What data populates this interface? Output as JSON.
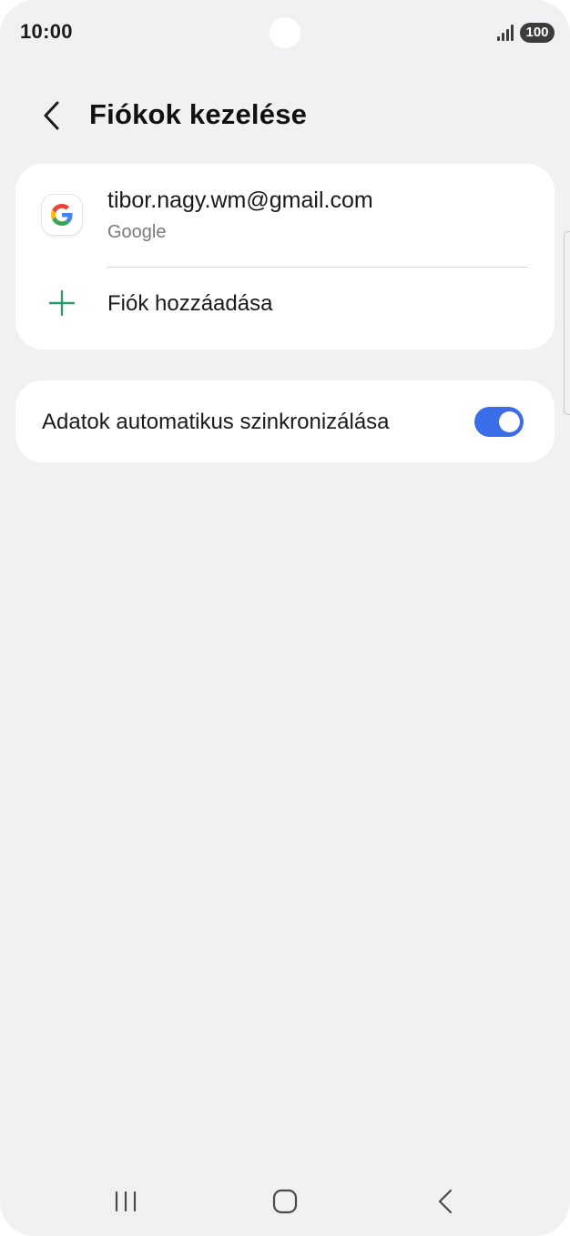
{
  "status_bar": {
    "time": "10:00",
    "battery": "100",
    "icons": [
      "signal-icon",
      "battery-icon"
    ]
  },
  "header": {
    "title": "Fiókok kezelése",
    "back_icon": "back-chevron-icon"
  },
  "accounts": {
    "items": [
      {
        "email": "tibor.nagy.wm@gmail.com",
        "type": "Google",
        "icon": "google-icon"
      }
    ],
    "add_label": "Fiók hozzáadása",
    "add_icon": "plus-icon"
  },
  "sync": {
    "label": "Adatok automatikus szinkronizálása",
    "enabled": true
  },
  "navigation": {
    "icons": [
      "recents-icon",
      "home-icon",
      "back-icon"
    ]
  },
  "colors": {
    "background": "#f1f1f3",
    "card": "#ffffff",
    "accent": "#3a6ee8",
    "plus": "#2e9b6c"
  }
}
